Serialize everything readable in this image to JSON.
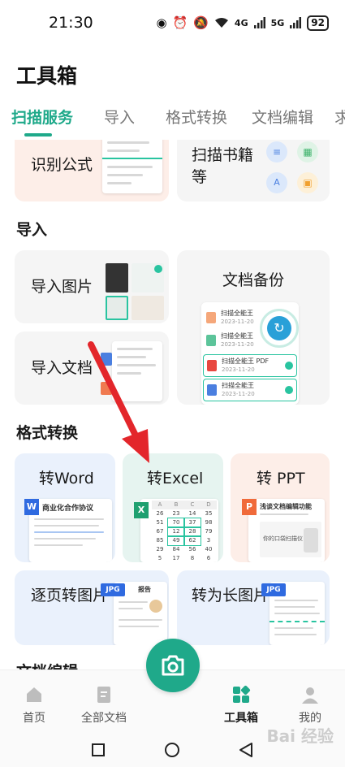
{
  "status_bar": {
    "time": "21:30",
    "signal1": "4G",
    "signal2": "5G",
    "battery": "92"
  },
  "page_title": "工具箱",
  "tabs": [
    {
      "label": "扫描服务",
      "active": true
    },
    {
      "label": "导入",
      "active": false
    },
    {
      "label": "格式转换",
      "active": false
    },
    {
      "label": "文档编辑",
      "active": false
    },
    {
      "label": "求",
      "active": false
    }
  ],
  "scan": {
    "formula_label": "识别公式",
    "books_label": "扫描书籍等"
  },
  "import_section": {
    "title": "导入",
    "import_image": "导入图片",
    "import_doc": "导入文档",
    "backup": {
      "title": "文档备份",
      "files": [
        {
          "name": "扫描全能王",
          "date": "2023-11-20",
          "color": "#f5a77a",
          "letter": "P"
        },
        {
          "name": "扫描全能王",
          "date": "2023-11-20",
          "color": "#5cc49a",
          "letter": "X"
        },
        {
          "name": "扫描全能王 PDF",
          "date": "2023-11-20",
          "color": "#e8473f",
          "letter": "A"
        },
        {
          "name": "扫描全能王",
          "date": "2023-11-20",
          "color": "#4a7fe0",
          "letter": "W"
        }
      ]
    }
  },
  "convert_section": {
    "title": "格式转换",
    "to_word": "转Word",
    "to_excel": "转Excel",
    "to_ppt": "转 PPT",
    "word_doc_title": "商业化合作协议",
    "ppt_title": "浅谈文档编辑功能",
    "ppt_sub": "你的口袋扫描仪",
    "page_to_image": "逐页转图片",
    "to_long_image": "转为长图片",
    "jpg": "JPG",
    "report": "报告"
  },
  "edit_section": {
    "title": "文档编辑"
  },
  "excel_grid": {
    "cols": [
      "A",
      "B",
      "C",
      "D"
    ],
    "rows": [
      [
        "26",
        "23",
        "14",
        "35"
      ],
      [
        "51",
        "70",
        "37",
        "98"
      ],
      [
        "67",
        "12",
        "28",
        "79"
      ],
      [
        "85",
        "49",
        "62",
        "3"
      ],
      [
        "29",
        "84",
        "56",
        "40"
      ],
      [
        "5",
        "17",
        "8",
        "6"
      ]
    ]
  },
  "bottom_nav": {
    "home": "首页",
    "all_docs": "全部文档",
    "toolbox": "工具箱",
    "mine": "我的"
  },
  "watermark": "Bai 经验",
  "colors": {
    "accent": "#1fa98a",
    "arrow": "#e3262b"
  }
}
